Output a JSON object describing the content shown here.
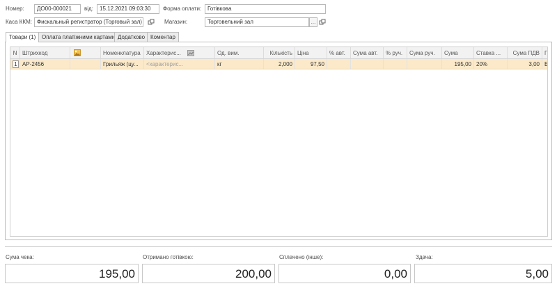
{
  "header": {
    "number_label": "Номер:",
    "number_value": "ДО00-000021",
    "date_label": "від:",
    "date_value": "15.12.2021 09:03:30",
    "payment_form_label": "Форма оплати:",
    "payment_form_value": "Готівкова",
    "cash_register_label": "Каса ККМ:",
    "cash_register_value": "Фискальный регистратор (Торговый зал)",
    "store_label": "Магазин:",
    "store_value": "Торговельний зал",
    "select_button": "..."
  },
  "tabs": [
    {
      "label": "Товари (1)",
      "active": true
    },
    {
      "label": "Оплата платіжними картами",
      "active": false
    },
    {
      "label": "Додатково",
      "active": false
    },
    {
      "label": "Коментар",
      "active": false
    }
  ],
  "table": {
    "columns": [
      "N",
      "Штрихкод",
      "",
      "Номенклатура",
      "Характерис...",
      "",
      "Од. вим.",
      "Кількість",
      "Ціна",
      "% авт.",
      "Сума авт.",
      "% руч.",
      "Сума руч.",
      "Сума",
      "Ставка ...",
      "Сума ПДВ",
      "П"
    ],
    "rows": [
      {
        "n": "1",
        "barcode": "АР-2456",
        "nomenclature": "Грильяж (цу...",
        "characteristic": "<характерис...",
        "unit": "кг",
        "quantity": "2,000",
        "price": "97,50",
        "auto_pct": "",
        "auto_sum": "",
        "man_pct": "",
        "man_sum": "",
        "sum": "195,00",
        "vat_rate": "20%",
        "vat_sum": "3,00",
        "p": "Б"
      }
    ]
  },
  "totals": {
    "receipt_sum_label": "Сума чека:",
    "receipt_sum_value": "195,00",
    "cash_received_label": "Отримано готівкою:",
    "cash_received_value": "200,00",
    "paid_other_label": "Сплачено (інше):",
    "paid_other_value": "0,00",
    "change_label": "Здача:",
    "change_value": "5,00"
  },
  "colors": {
    "selected_row": "#fbe9c9",
    "header_bg": "#f2f2f2"
  }
}
